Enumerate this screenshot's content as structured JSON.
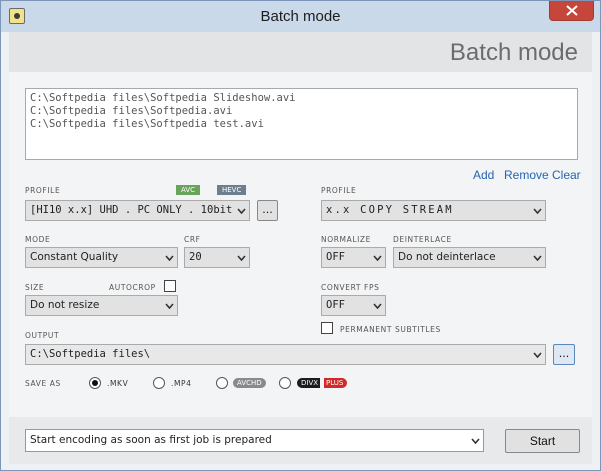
{
  "window": {
    "title": "Batch mode",
    "header_title": "Batch mode"
  },
  "files": [
    "C:\\Softpedia files\\Softpedia Slideshow.avi",
    "C:\\Softpedia files\\Softpedia.avi",
    "C:\\Softpedia files\\Softpedia test.avi"
  ],
  "list_actions": {
    "add": "Add",
    "remove": "Remove",
    "clear": "Clear"
  },
  "video": {
    "profile_label": "PROFILE",
    "codec_badges": {
      "avc": "AVC",
      "hevc": "HEVC"
    },
    "profile_value": "[HI10 x.x] UHD . PC ONLY . 10bit",
    "profile_more": "...",
    "mode_label": "MODE",
    "mode_value": "Constant Quality",
    "crf_label": "CRF",
    "crf_value": "20",
    "size_label": "SIZE",
    "size_value": "Do not resize",
    "autocrop_label": "AUTOCROP"
  },
  "audio": {
    "profile_label": "PROFILE",
    "profile_value": "x.x COPY  STREAM",
    "normalize_label": "NORMALIZE",
    "normalize_value": "OFF",
    "deinterlace_label": "DEINTERLACE",
    "deinterlace_value": "Do not deinterlace",
    "convert_fps_label": "CONVERT FPS",
    "convert_fps_value": "OFF",
    "permanent_subtitles_label": "PERMANENT SUBTITLES"
  },
  "output": {
    "label": "OUTPUT",
    "path": "C:\\Softpedia files\\",
    "browse": "..."
  },
  "save_as": {
    "label": "SAVE AS",
    "options": [
      {
        "label": ".MKV",
        "selected": true
      },
      {
        "label": ".MP4",
        "selected": false
      },
      {
        "label": "AVCHD",
        "selected": false
      },
      {
        "label": "DIVX",
        "label2": "PLUS",
        "selected": false
      }
    ]
  },
  "footer": {
    "start_mode_value": "Start encoding as soon as first job is prepared",
    "start_button": "Start"
  },
  "colors": {
    "avc_badge": "#6aa35c",
    "hevc_badge": "#6d7e8f",
    "avchd_pill": "#8a8a8a",
    "divx_pill": "#1c1c1c",
    "plus_pill": "#d12a2a",
    "link": "#2764b0",
    "close_button": "#c7463b"
  }
}
